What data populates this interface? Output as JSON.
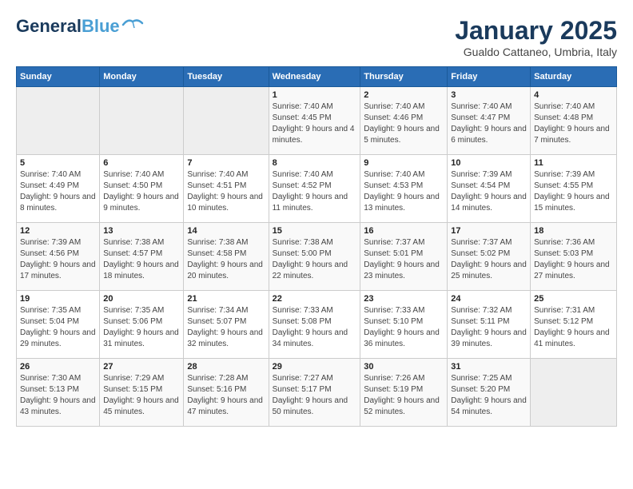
{
  "header": {
    "logo_general": "General",
    "logo_blue": "Blue",
    "title": "January 2025",
    "subtitle": "Gualdo Cattaneo, Umbria, Italy"
  },
  "days_of_week": [
    "Sunday",
    "Monday",
    "Tuesday",
    "Wednesday",
    "Thursday",
    "Friday",
    "Saturday"
  ],
  "weeks": [
    [
      {
        "day": "",
        "sunrise": "",
        "sunset": "",
        "daylight": ""
      },
      {
        "day": "",
        "sunrise": "",
        "sunset": "",
        "daylight": ""
      },
      {
        "day": "",
        "sunrise": "",
        "sunset": "",
        "daylight": ""
      },
      {
        "day": "1",
        "sunrise": "Sunrise: 7:40 AM",
        "sunset": "Sunset: 4:45 PM",
        "daylight": "Daylight: 9 hours and 4 minutes."
      },
      {
        "day": "2",
        "sunrise": "Sunrise: 7:40 AM",
        "sunset": "Sunset: 4:46 PM",
        "daylight": "Daylight: 9 hours and 5 minutes."
      },
      {
        "day": "3",
        "sunrise": "Sunrise: 7:40 AM",
        "sunset": "Sunset: 4:47 PM",
        "daylight": "Daylight: 9 hours and 6 minutes."
      },
      {
        "day": "4",
        "sunrise": "Sunrise: 7:40 AM",
        "sunset": "Sunset: 4:48 PM",
        "daylight": "Daylight: 9 hours and 7 minutes."
      }
    ],
    [
      {
        "day": "5",
        "sunrise": "Sunrise: 7:40 AM",
        "sunset": "Sunset: 4:49 PM",
        "daylight": "Daylight: 9 hours and 8 minutes."
      },
      {
        "day": "6",
        "sunrise": "Sunrise: 7:40 AM",
        "sunset": "Sunset: 4:50 PM",
        "daylight": "Daylight: 9 hours and 9 minutes."
      },
      {
        "day": "7",
        "sunrise": "Sunrise: 7:40 AM",
        "sunset": "Sunset: 4:51 PM",
        "daylight": "Daylight: 9 hours and 10 minutes."
      },
      {
        "day": "8",
        "sunrise": "Sunrise: 7:40 AM",
        "sunset": "Sunset: 4:52 PM",
        "daylight": "Daylight: 9 hours and 11 minutes."
      },
      {
        "day": "9",
        "sunrise": "Sunrise: 7:40 AM",
        "sunset": "Sunset: 4:53 PM",
        "daylight": "Daylight: 9 hours and 13 minutes."
      },
      {
        "day": "10",
        "sunrise": "Sunrise: 7:39 AM",
        "sunset": "Sunset: 4:54 PM",
        "daylight": "Daylight: 9 hours and 14 minutes."
      },
      {
        "day": "11",
        "sunrise": "Sunrise: 7:39 AM",
        "sunset": "Sunset: 4:55 PM",
        "daylight": "Daylight: 9 hours and 15 minutes."
      }
    ],
    [
      {
        "day": "12",
        "sunrise": "Sunrise: 7:39 AM",
        "sunset": "Sunset: 4:56 PM",
        "daylight": "Daylight: 9 hours and 17 minutes."
      },
      {
        "day": "13",
        "sunrise": "Sunrise: 7:38 AM",
        "sunset": "Sunset: 4:57 PM",
        "daylight": "Daylight: 9 hours and 18 minutes."
      },
      {
        "day": "14",
        "sunrise": "Sunrise: 7:38 AM",
        "sunset": "Sunset: 4:58 PM",
        "daylight": "Daylight: 9 hours and 20 minutes."
      },
      {
        "day": "15",
        "sunrise": "Sunrise: 7:38 AM",
        "sunset": "Sunset: 5:00 PM",
        "daylight": "Daylight: 9 hours and 22 minutes."
      },
      {
        "day": "16",
        "sunrise": "Sunrise: 7:37 AM",
        "sunset": "Sunset: 5:01 PM",
        "daylight": "Daylight: 9 hours and 23 minutes."
      },
      {
        "day": "17",
        "sunrise": "Sunrise: 7:37 AM",
        "sunset": "Sunset: 5:02 PM",
        "daylight": "Daylight: 9 hours and 25 minutes."
      },
      {
        "day": "18",
        "sunrise": "Sunrise: 7:36 AM",
        "sunset": "Sunset: 5:03 PM",
        "daylight": "Daylight: 9 hours and 27 minutes."
      }
    ],
    [
      {
        "day": "19",
        "sunrise": "Sunrise: 7:35 AM",
        "sunset": "Sunset: 5:04 PM",
        "daylight": "Daylight: 9 hours and 29 minutes."
      },
      {
        "day": "20",
        "sunrise": "Sunrise: 7:35 AM",
        "sunset": "Sunset: 5:06 PM",
        "daylight": "Daylight: 9 hours and 31 minutes."
      },
      {
        "day": "21",
        "sunrise": "Sunrise: 7:34 AM",
        "sunset": "Sunset: 5:07 PM",
        "daylight": "Daylight: 9 hours and 32 minutes."
      },
      {
        "day": "22",
        "sunrise": "Sunrise: 7:33 AM",
        "sunset": "Sunset: 5:08 PM",
        "daylight": "Daylight: 9 hours and 34 minutes."
      },
      {
        "day": "23",
        "sunrise": "Sunrise: 7:33 AM",
        "sunset": "Sunset: 5:10 PM",
        "daylight": "Daylight: 9 hours and 36 minutes."
      },
      {
        "day": "24",
        "sunrise": "Sunrise: 7:32 AM",
        "sunset": "Sunset: 5:11 PM",
        "daylight": "Daylight: 9 hours and 39 minutes."
      },
      {
        "day": "25",
        "sunrise": "Sunrise: 7:31 AM",
        "sunset": "Sunset: 5:12 PM",
        "daylight": "Daylight: 9 hours and 41 minutes."
      }
    ],
    [
      {
        "day": "26",
        "sunrise": "Sunrise: 7:30 AM",
        "sunset": "Sunset: 5:13 PM",
        "daylight": "Daylight: 9 hours and 43 minutes."
      },
      {
        "day": "27",
        "sunrise": "Sunrise: 7:29 AM",
        "sunset": "Sunset: 5:15 PM",
        "daylight": "Daylight: 9 hours and 45 minutes."
      },
      {
        "day": "28",
        "sunrise": "Sunrise: 7:28 AM",
        "sunset": "Sunset: 5:16 PM",
        "daylight": "Daylight: 9 hours and 47 minutes."
      },
      {
        "day": "29",
        "sunrise": "Sunrise: 7:27 AM",
        "sunset": "Sunset: 5:17 PM",
        "daylight": "Daylight: 9 hours and 50 minutes."
      },
      {
        "day": "30",
        "sunrise": "Sunrise: 7:26 AM",
        "sunset": "Sunset: 5:19 PM",
        "daylight": "Daylight: 9 hours and 52 minutes."
      },
      {
        "day": "31",
        "sunrise": "Sunrise: 7:25 AM",
        "sunset": "Sunset: 5:20 PM",
        "daylight": "Daylight: 9 hours and 54 minutes."
      },
      {
        "day": "",
        "sunrise": "",
        "sunset": "",
        "daylight": ""
      }
    ]
  ]
}
